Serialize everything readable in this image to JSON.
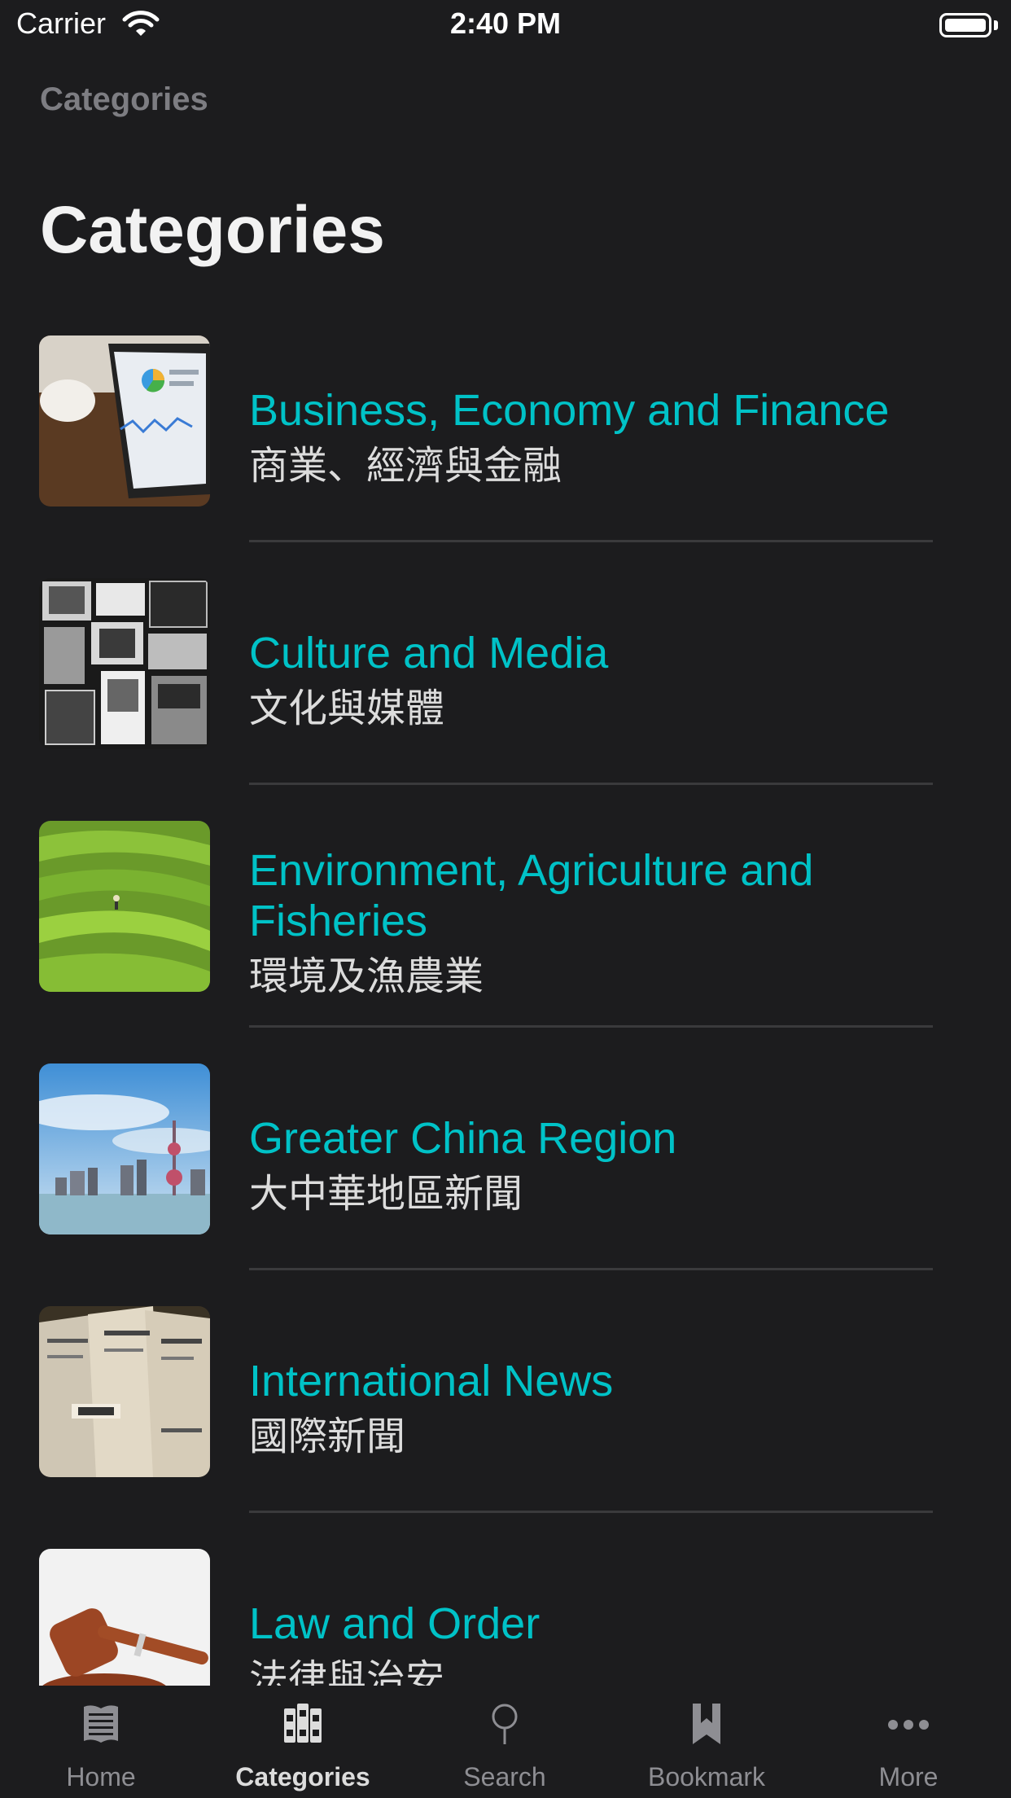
{
  "status_bar": {
    "carrier": "Carrier",
    "time": "2:40 PM"
  },
  "nav": {
    "small_title": "Categories",
    "large_title": "Categories"
  },
  "categories": [
    {
      "title": "Business, Economy and Finance",
      "subtitle": "商業、經濟與金融",
      "thumbnail": "tablet-chart-photo"
    },
    {
      "title": "Culture and Media",
      "subtitle": "文化與媒體",
      "thumbnail": "tv-collage-photo"
    },
    {
      "title": "Environment, Agriculture and Fisheries",
      "subtitle": "環境及漁農業",
      "thumbnail": "rice-terrace-photo"
    },
    {
      "title": "Greater China Region",
      "subtitle": "大中華地區新聞",
      "thumbnail": "city-skyline-photo"
    },
    {
      "title": "International News",
      "subtitle": "國際新聞",
      "thumbnail": "newspapers-photo"
    },
    {
      "title": "Law and Order",
      "subtitle": "法律與治安",
      "thumbnail": "gavel-photo"
    }
  ],
  "tabs": [
    {
      "label": "Home",
      "icon": "newspaper-icon",
      "active": false
    },
    {
      "label": "Categories",
      "icon": "books-icon",
      "active": true
    },
    {
      "label": "Search",
      "icon": "search-icon",
      "active": false
    },
    {
      "label": "Bookmark",
      "icon": "bookmark-icon",
      "active": false
    },
    {
      "label": "More",
      "icon": "more-icon",
      "active": false
    }
  ],
  "colors": {
    "background": "#1c1c1e",
    "accent": "#00c2c7",
    "inactive": "#8e8e93"
  }
}
